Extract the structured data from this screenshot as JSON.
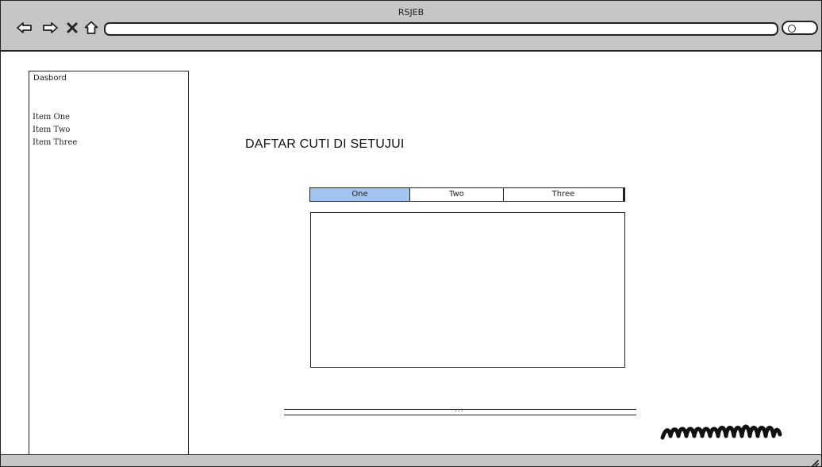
{
  "window": {
    "title": "RSJEB"
  },
  "toolbar": {
    "back_icon": "back-arrow-icon",
    "forward_icon": "forward-arrow-icon",
    "close_icon": "close-icon",
    "home_icon": "home-icon",
    "address_value": "",
    "search_icon": "search-icon"
  },
  "sidebar": {
    "title": "Dasbord",
    "items": [
      {
        "label": "Item One"
      },
      {
        "label": "Item Two"
      },
      {
        "label": "Item Three"
      }
    ]
  },
  "main": {
    "title": "DAFTAR CUTI DI SETUJUI",
    "tabs": [
      {
        "label": "One",
        "active": true
      },
      {
        "label": "Two",
        "active": false
      },
      {
        "label": "Three",
        "active": false
      }
    ],
    "pager_text": "..."
  },
  "colors": {
    "chrome": "#c6c6c6",
    "active_tab": "#a2c4f0",
    "ink": "#222222"
  }
}
